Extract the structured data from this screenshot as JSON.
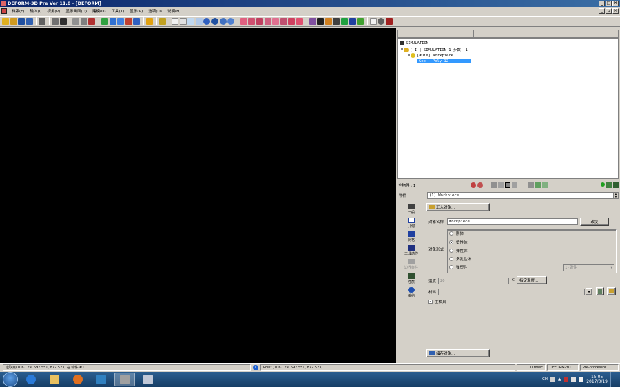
{
  "window": {
    "title": "DEFORM-3D Pre Ver 11.0 - [DEFORM]"
  },
  "menu": [
    "档案(F)",
    "输入(I)",
    "视角(V)",
    "显示画面(D)",
    "建模(O)",
    "工具(T)",
    "显示(V)",
    "选项(O)",
    "说明(H)"
  ],
  "tree": {
    "root": "SIMULATION",
    "sim": "[ I ]  SIMULATION 1  步数 -1",
    "object": "[#Die] Workpiece",
    "geo": "Geo - Poly 12"
  },
  "objects_bar": {
    "count_label": "全物件 : 1"
  },
  "object_row": {
    "label": "物件",
    "selected": "(1) Workpiece"
  },
  "sidebar": [
    {
      "label": "一般",
      "icon": "general-icon",
      "disabled": false
    },
    {
      "label": "几何",
      "icon": "geometry-icon",
      "disabled": false
    },
    {
      "label": "网格",
      "icon": "mesh-icon",
      "disabled": false
    },
    {
      "label": "工具动作",
      "icon": "movement-icon",
      "disabled": false
    },
    {
      "label": "边界条件",
      "icon": "bcc-icon",
      "disabled": true
    },
    {
      "label": "性质",
      "icon": "property-icon",
      "disabled": false
    },
    {
      "label": "缩约",
      "icon": "contact-icon",
      "disabled": false
    }
  ],
  "panel": {
    "import_button": "汇入对象...",
    "name_label": "对象名称",
    "name_value": "Workpiece",
    "change_button": "改变",
    "type_label": "对象形式",
    "types": [
      {
        "label": "刚体",
        "checked": false
      },
      {
        "label": "塑性体",
        "checked": true
      },
      {
        "label": "弹性体",
        "checked": false
      },
      {
        "label": "多孔性体",
        "checked": false
      },
      {
        "label": "弹塑性",
        "checked": false
      }
    ],
    "elastic_dropdown": "1-弹性",
    "temp_label": "温度",
    "temp_value": "20",
    "temp_unit": "C",
    "assign_temp_button": "指定温度...",
    "material_label": "材料",
    "material_value": "",
    "primary_die_label": "主模具",
    "primary_die_checked": true,
    "save_button": "储存对象..."
  },
  "status": {
    "left": "选取点(1067.79, 697.551, 872.523) 在 物件 #1",
    "point": "Point (1067.79, 697.551, 872.523)",
    "time": "0 msec",
    "app": "DEFORM-3D",
    "mode": "Pre-processor"
  },
  "taskbar": {
    "lang": "CH",
    "time": "15:05",
    "date": "2017/3/19"
  }
}
